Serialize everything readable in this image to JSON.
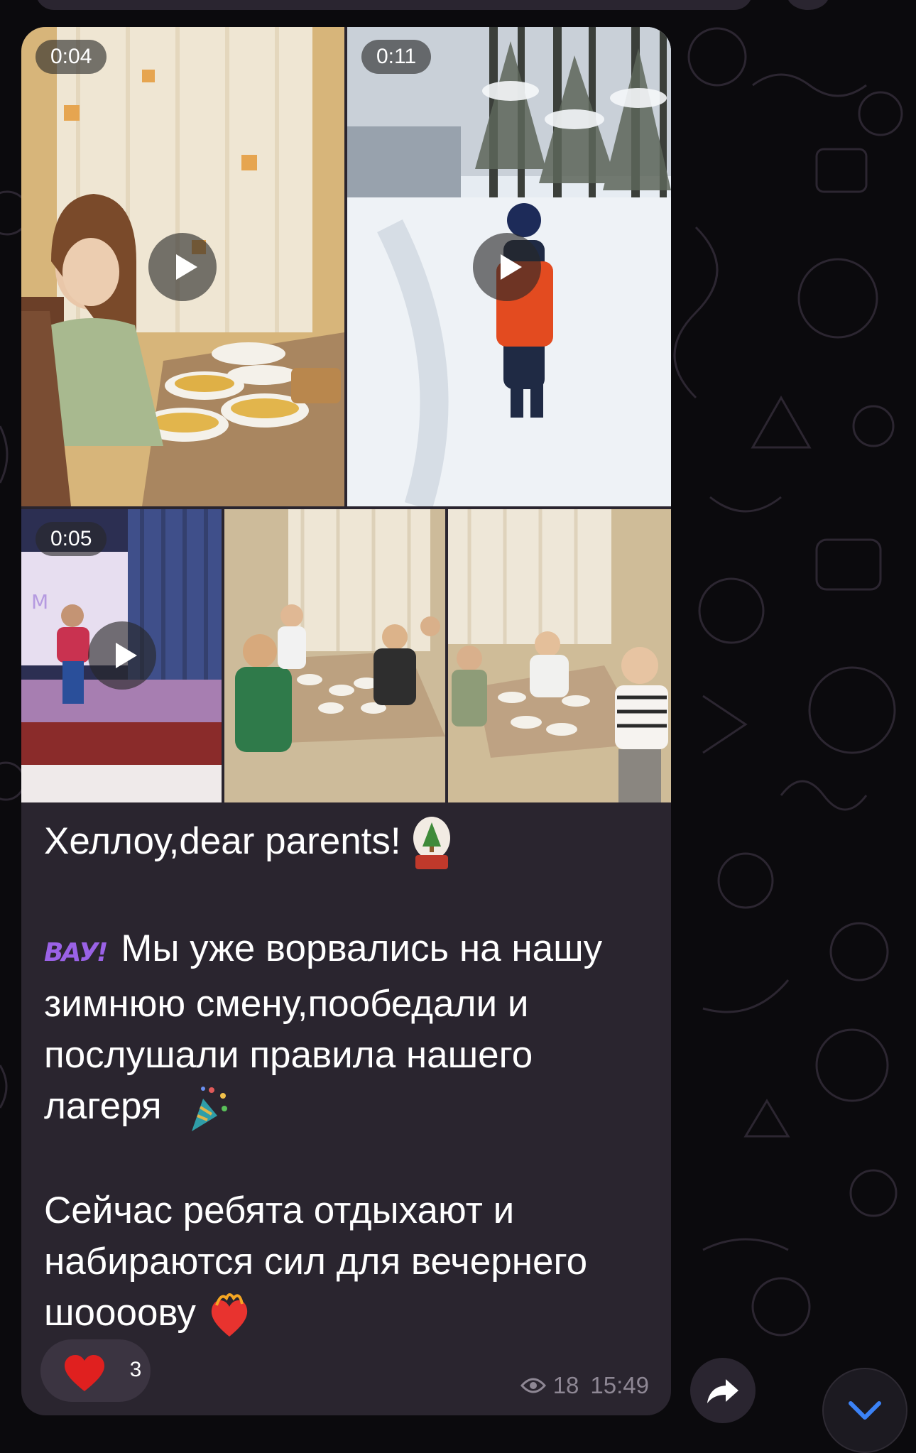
{
  "post": {
    "media": [
      {
        "kind": "video",
        "duration": "0:04"
      },
      {
        "kind": "video",
        "duration": "0:11"
      },
      {
        "kind": "video",
        "duration": "0:05"
      },
      {
        "kind": "photo"
      },
      {
        "kind": "photo"
      }
    ],
    "caption": {
      "line1": "Хеллоу,dear parents!",
      "wow_sticker": "ВАУ!",
      "p2_line1": " Мы уже ворвались на нашу",
      "p2_line2": "зимнюю смену,пообедали и",
      "p2_line3": "послушали правила нашего",
      "p2_line4": "лагеря",
      "p3_line1": "Сейчас ребята отдыхают и",
      "p3_line2": "набираются сил для вечернего",
      "p3_line3": "шоооову"
    },
    "reaction": {
      "icon": "heart-icon",
      "count": "3"
    },
    "views": "18",
    "time": "15:49"
  },
  "colors": {
    "bubble": "#2a252f",
    "text": "#ffffff",
    "meta": "#8e8794",
    "accent": "#9a62e6",
    "reaction_bg": "#3b3441"
  }
}
